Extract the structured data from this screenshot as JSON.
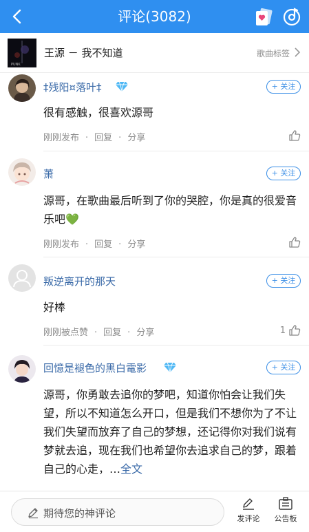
{
  "header": {
    "title": "评论",
    "count": "(3082)",
    "colors": {
      "bar": "#2f8ff0"
    }
  },
  "song": {
    "title": "王源 － 我不知道",
    "tag_label": "歌曲标签"
  },
  "comments": [
    {
      "user": "‡残阳¤落叶‡",
      "vip": true,
      "follow_label": "+ 关注",
      "text": "很有感触，很喜欢源哥",
      "time": "刚刚发布",
      "reply": "回复",
      "share": "分享",
      "likes": ""
    },
    {
      "user": "萧",
      "vip": false,
      "follow_label": "+ 关注",
      "text": "源哥，在歌曲最后听到了你的哭腔，你是真的很爱音乐吧💚",
      "time": "刚刚发布",
      "reply": "回复",
      "share": "分享",
      "likes": ""
    },
    {
      "user": "叛逆离开的那天",
      "vip": false,
      "follow_label": "+ 关注",
      "text": "好棒",
      "time": "刚刚被点赞",
      "reply": "回复",
      "share": "分享",
      "likes": "1"
    },
    {
      "user": "回憶是褪色的黑白電影",
      "vip": true,
      "follow_label": "+ 关注",
      "text": "源哥，你勇敢去追你的梦吧，知道你怕会让我们失望，所以不知道怎么开口，但是我们不想你为了不让我们失望而放弃了自己的梦想，还记得你对我们说有梦就去追，现在我们也希望你去追求自己的梦，跟着自己的心走，…",
      "more_label": "全文"
    }
  ],
  "bottom": {
    "placeholder": "期待您的神评论",
    "post_label": "发评论",
    "board_label": "公告板"
  },
  "icons": [
    "back-arrow-icon",
    "card-heart-icon",
    "music-disc-icon",
    "chevron-right-icon",
    "diamond-vip-icon",
    "thumb-up-icon",
    "pencil-icon",
    "board-icon"
  ]
}
